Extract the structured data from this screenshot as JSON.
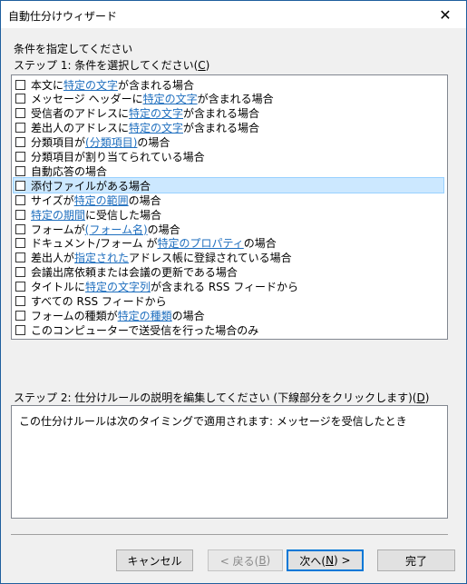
{
  "window": {
    "title": "自動仕分けウィザード",
    "close_icon": "close-icon"
  },
  "section_title": "条件を指定してください",
  "step1": {
    "label": "ステップ 1: 条件を選択してください(",
    "accel": "C",
    "suffix": ")"
  },
  "conditions": [
    {
      "pre": "本文に ",
      "link": "特定の文字",
      "post": " が含まれる場合"
    },
    {
      "pre": "メッセージ ヘッダーに ",
      "link": "特定の文字",
      "post": " が含まれる場合"
    },
    {
      "pre": "受信者のアドレスに ",
      "link": "特定の文字",
      "post": " が含まれる場合"
    },
    {
      "pre": "差出人のアドレスに ",
      "link": "特定の文字",
      "post": " が含まれる場合"
    },
    {
      "pre": "分類項目が ",
      "link": "(分類項目)",
      "post": " の場合"
    },
    {
      "pre": "分類項目が割り当てられている場合",
      "link": "",
      "post": ""
    },
    {
      "pre": "自動応答の場合",
      "link": "",
      "post": ""
    },
    {
      "pre": "添付ファイルがある場合",
      "link": "",
      "post": "",
      "selected": true
    },
    {
      "pre": "サイズが ",
      "link": "特定の範囲",
      "post": " の場合"
    },
    {
      "pre": "",
      "link": "特定の期間",
      "post": " に受信した場合"
    },
    {
      "pre": "フォームが ",
      "link": "(フォーム名)",
      "post": " の場合"
    },
    {
      "pre": "ドキュメント/フォーム が ",
      "link": "特定のプロパティ",
      "post": " の場合"
    },
    {
      "pre": "差出人が ",
      "link": "指定された",
      "post": " アドレス帳に登録されている場合"
    },
    {
      "pre": "会議出席依頼または会議の更新である場合",
      "link": "",
      "post": ""
    },
    {
      "pre": "タイトルに ",
      "link": "特定の文字列",
      "post": " が含まれる RSS フィードから"
    },
    {
      "pre": "すべての RSS フィードから",
      "link": "",
      "post": ""
    },
    {
      "pre": "フォームの種類が ",
      "link": "特定の種類",
      "post": " の場合"
    },
    {
      "pre": "このコンピューターで送受信を行った場合のみ",
      "link": "",
      "post": ""
    }
  ],
  "step2": {
    "label": "ステップ 2: 仕分けルールの説明を編集してください (下線部分をクリックします)(",
    "accel": "D",
    "suffix": ")"
  },
  "description": "この仕分けルールは次のタイミングで適用されます: メッセージを受信したとき",
  "buttons": {
    "cancel": "キャンセル",
    "back_pre": "< 戻る(",
    "back_accel": "B",
    "back_post": ")",
    "next_pre": "次へ(",
    "next_accel": "N",
    "next_post": ") >",
    "finish": "完了"
  }
}
